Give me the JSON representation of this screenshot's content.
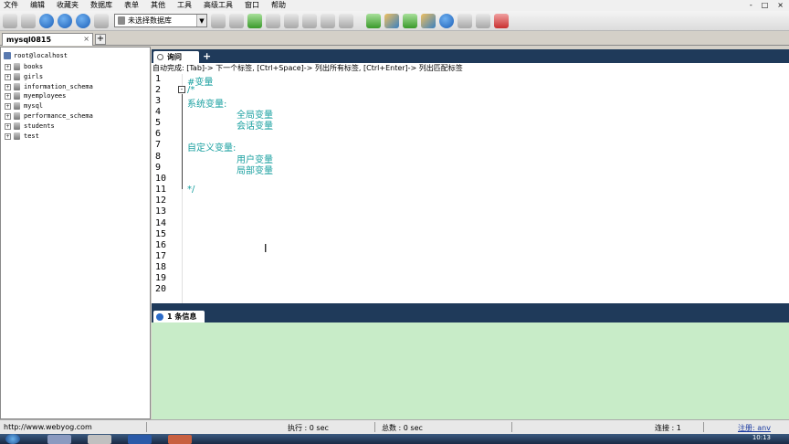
{
  "menu": [
    "文件",
    "编辑",
    "收藏夹",
    "数据库",
    "表单",
    "其他",
    "工具",
    "高级工具",
    "窗口",
    "帮助"
  ],
  "window_controls": [
    "-",
    "□",
    "×"
  ],
  "toolbar": {
    "db_select_value": "未选择数据库"
  },
  "connection": {
    "tab_label": "mysql0815",
    "close_glyph": "×",
    "add_glyph": "+"
  },
  "object_browser": {
    "root": "root@localhost",
    "databases": [
      "books",
      "girls",
      "information_schema",
      "myemployees",
      "mysql",
      "performance_schema",
      "students",
      "test"
    ],
    "expand_glyph": "+"
  },
  "editor": {
    "tab_label": "询问",
    "add_glyph": "+",
    "hint": "自动完成: [Tab]-> 下一个标签, [Ctrl+Space]-> 列出所有标签, [Ctrl+Enter]-> 列出匹配标签",
    "line_numbers": [
      "1",
      "2",
      "3",
      "4",
      "5",
      "6",
      "7",
      "8",
      "9",
      "10",
      "11",
      "12",
      "13",
      "14",
      "15",
      "16",
      "17",
      "18",
      "19",
      "20"
    ],
    "fold_glyph": "-",
    "code": {
      "l1": "#变量",
      "l2": "/*",
      "l3": "系统变量:",
      "l4": "全局变量",
      "l5": "会话变量",
      "l7": "自定义变量:",
      "l8": "用户变量",
      "l9": "局部变量",
      "l11": "*/"
    },
    "cursor_glyph": "I"
  },
  "messages": {
    "tab_label": "1 条信息"
  },
  "status": {
    "url": "http://www.webyog.com",
    "exec": "执行 : 0 sec",
    "total": "总数 : 0 sec",
    "conn": "连接 : 1",
    "reg": "注册: anv"
  },
  "taskbar": {
    "clock": "10:13"
  }
}
